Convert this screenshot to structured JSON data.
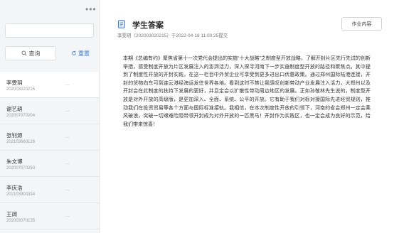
{
  "sidebar": {
    "more_label": "•••",
    "search": {
      "value": "",
      "placeholder": ""
    },
    "query_button": "查询",
    "reset_button": "重置",
    "items": [
      {
        "name": "李雯玥",
        "id": "202003020215",
        "action": "...",
        "active": true
      },
      {
        "name": "谢艺萌",
        "id": "202007070204",
        "action": "..."
      },
      {
        "name": "张钊源",
        "id": "202103660126",
        "action": "..."
      },
      {
        "name": "朱文博",
        "id": "202007070250",
        "action": "..."
      },
      {
        "name": "李庆浩",
        "id": "202103900334",
        "action": "..."
      },
      {
        "name": "王阔",
        "id": "202003070135",
        "action": "..."
      }
    ]
  },
  "main": {
    "title": "学生答案",
    "meta": "李雯玥（202003020215）于2022-04-18 11:00:25提交",
    "content_button": "作业内容",
    "answer": "本期《总编有约》聚焦省第十一次党代会提出的实施“十大战略”之制度型开放战略，了解开封片区先行先试的创新举措，感受制度开放为片区发展注入的澎湃活力，深入探寻河南下一步实施制度型开放的路径和聚焦点。其中提到了制度性开放的开封实践，在这一栏目中外贸企业可享受到更多进出口优惠政策。通过郑州国际陆港连接，开封的货物向东可到连云港经海运发往世界各地。看到这时不禁让我感叹创新带动产业发展注入活力，大郑州以及开封会在此制度的扶持下发展的更好，并且定会以扩散性带动周边地区的发展。正如孙敬林先生说的，制度型开放是对外开放的高级版，是更加深入、全面、系统、公平的开放。它有助于我们对标对接国际先进经贸规则，推动我们在投资贸易等各个方面与国际标准接轨。我相信，在本次制度性开放的引领下，河南的省会郑州一定会乘风破浪，突破一切艰难险阻带领开封成为对外开放的一匹黑马！开封作为实践区，也一定会成为良好的示范，给我们带来惊喜！"
  },
  "colors": {
    "accent": "#3a7be0",
    "sidebar_bg": "#f4f5f7"
  },
  "icons": {
    "title": "document-icon",
    "query": "search-icon",
    "reset": "refresh-icon"
  }
}
